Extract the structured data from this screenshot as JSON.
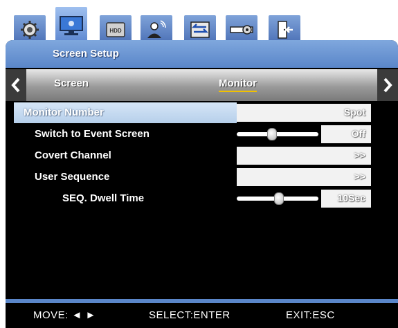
{
  "tabs": [
    {
      "icon": "gear-icon"
    },
    {
      "icon": "monitor-icon",
      "active": true
    },
    {
      "icon": "hdd-icon",
      "label": "HDD"
    },
    {
      "icon": "user-wifi-icon"
    },
    {
      "icon": "network-icon"
    },
    {
      "icon": "settings-slider-icon"
    },
    {
      "icon": "exit-door-icon"
    }
  ],
  "header": {
    "title": "Screen Setup"
  },
  "subtabs": {
    "screen": "Screen",
    "monitor": "Monitor"
  },
  "rows": [
    {
      "label": "Monitor Number",
      "value": "Spot"
    },
    {
      "label": "Switch to Event Screen",
      "value": "Off",
      "slider_level": 0.45
    },
    {
      "label": "Covert Channel",
      "value": ">>"
    },
    {
      "label": "User Sequence",
      "value": ">>"
    },
    {
      "label": "SEQ. Dwell Time",
      "value": "10Sec",
      "slider_level": 0.55
    }
  ],
  "footer": {
    "move": "MOVE: ◄ ►",
    "select": "SELECT:ENTER",
    "exit": "EXIT:ESC"
  },
  "colors": {
    "header_blue": "#6a93d2",
    "selected_row": "#c4d9ef",
    "highlight_underline": "#f0c000"
  }
}
